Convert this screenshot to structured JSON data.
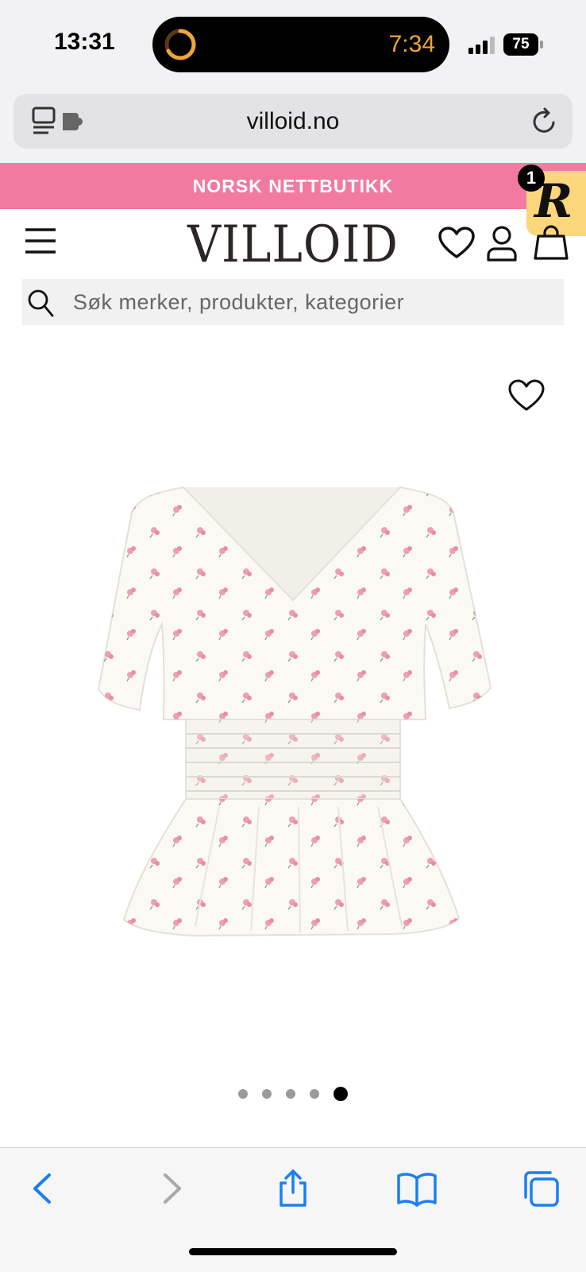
{
  "status_bar": {
    "time": "13:31",
    "activity_timer": "7:34",
    "battery_percent": "75"
  },
  "browser": {
    "url": "villoid.no"
  },
  "promo_banner": {
    "text": "NORSK NETTBUTIKK"
  },
  "badge": {
    "letter": "R",
    "count": "1"
  },
  "header": {
    "logo": "VILLOID"
  },
  "search": {
    "placeholder": "Søk merker, produkter, kategorier"
  },
  "gallery": {
    "image_count": 5,
    "active_index": 5
  },
  "colors": {
    "promo": "#f27aa0",
    "badge": "#fcd67a",
    "accent": "#1a7ff0",
    "timer": "#f0a43a"
  },
  "icons": [
    "tabs-icon",
    "extension-icon",
    "reload-icon",
    "menu-icon",
    "heart-icon",
    "user-icon",
    "bag-icon",
    "search-icon",
    "back-icon",
    "forward-icon",
    "share-icon",
    "bookmarks-icon",
    "tabs-overview-icon"
  ]
}
